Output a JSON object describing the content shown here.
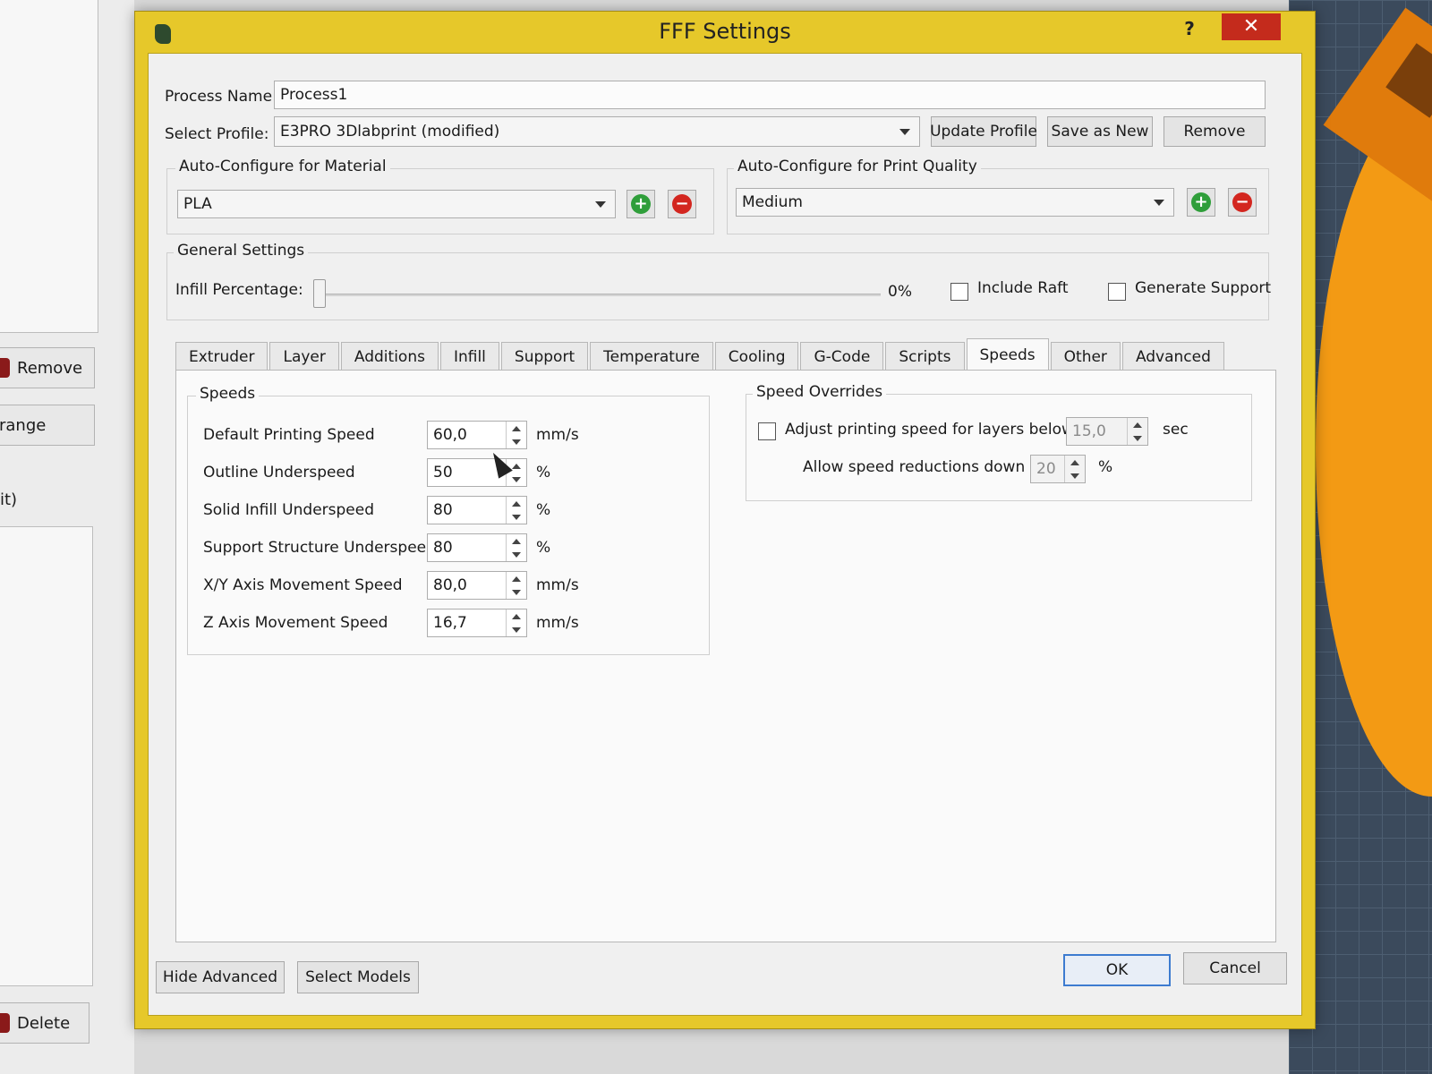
{
  "background": {
    "left_buttons": [
      "Remove",
      "range",
      "it)",
      "Delete"
    ]
  },
  "dialog": {
    "title": "FFF Settings",
    "help": "?",
    "close": "✕",
    "process_name_label": "Process Name:",
    "process_name_value": "Process1",
    "select_profile_label": "Select Profile:",
    "select_profile_value": "E3PRO 3Dlabprint (modified)",
    "update_profile": "Update Profile",
    "save_as_new": "Save as New",
    "remove": "Remove",
    "material_group": "Auto-Configure for Material",
    "material_value": "PLA",
    "quality_group": "Auto-Configure for Print Quality",
    "quality_value": "Medium",
    "general_group": "General Settings",
    "infill_label": "Infill Percentage:",
    "infill_value_text": "0%",
    "infill_value": 0,
    "include_raft": "Include Raft",
    "include_raft_checked": false,
    "generate_support": "Generate Support",
    "generate_support_checked": false,
    "tabs": [
      "Extruder",
      "Layer",
      "Additions",
      "Infill",
      "Support",
      "Temperature",
      "Cooling",
      "G-Code",
      "Scripts",
      "Speeds",
      "Other",
      "Advanced"
    ],
    "active_tab": "Speeds",
    "speeds": {
      "group": "Speeds",
      "rows": [
        {
          "label": "Default Printing Speed",
          "value": "60,0",
          "unit": "mm/s"
        },
        {
          "label": "Outline Underspeed",
          "value": "50",
          "unit": "%"
        },
        {
          "label": "Solid Infill Underspeed",
          "value": "80",
          "unit": "%"
        },
        {
          "label": "Support Structure Underspeed",
          "value": "80",
          "unit": "%"
        },
        {
          "label": "X/Y Axis Movement Speed",
          "value": "80,0",
          "unit": "mm/s"
        },
        {
          "label": "Z Axis Movement Speed",
          "value": "16,7",
          "unit": "mm/s"
        }
      ]
    },
    "overrides": {
      "group": "Speed Overrides",
      "adjust_label": "Adjust printing speed for layers below",
      "adjust_checked": false,
      "adjust_value": "15,0",
      "adjust_unit": "sec",
      "allow_label": "Allow speed reductions down to",
      "allow_value": "20",
      "allow_unit": "%"
    },
    "hide_advanced": "Hide Advanced",
    "select_models": "Select Models",
    "ok": "OK",
    "cancel": "Cancel"
  }
}
